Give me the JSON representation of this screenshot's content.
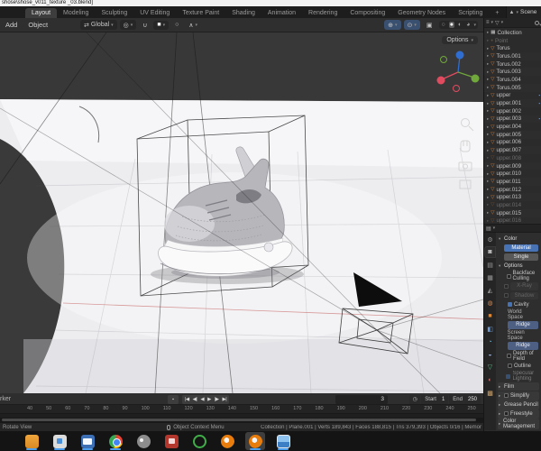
{
  "window": {
    "title": "shose\\shose_v011_texture _03.blend]"
  },
  "icons": {
    "scene": "▲",
    "list_display": "≡",
    "filter": "▽",
    "props_editor": "▤",
    "orientation": "⇄",
    "pivot": "◎",
    "magnet": "∪",
    "snap_target": "■",
    "proportional": "○",
    "falloff": "∧",
    "gizmo_toggle": "⊕",
    "overlays_toggle": "⊙",
    "xray_toggle": "▣",
    "shade_wireframe": "○",
    "shade_solid": "●",
    "shade_material": "◐",
    "shade_rendered": "◕",
    "clock": "◷",
    "record": "▪",
    "dropdown": "▾"
  },
  "topbar": {
    "tabs": [
      {
        "label": "Layout",
        "active": true
      },
      {
        "label": "Modeling"
      },
      {
        "label": "Sculpting"
      },
      {
        "label": "UV Editing"
      },
      {
        "label": "Texture Paint"
      },
      {
        "label": "Shading"
      },
      {
        "label": "Animation"
      },
      {
        "label": "Rendering"
      },
      {
        "label": "Compositing"
      },
      {
        "label": "Geometry Nodes"
      },
      {
        "label": "Scripting"
      },
      {
        "label": "+"
      }
    ],
    "scene_label": "Scene"
  },
  "viewport_header": {
    "menus": [
      {
        "label": "Add"
      },
      {
        "label": "Object"
      }
    ],
    "orientation_value": "Global"
  },
  "viewport": {
    "options_label": "Options"
  },
  "outliner": {
    "rows": [
      {
        "name": "Collection",
        "icon": "collection"
      },
      {
        "name": "Point",
        "icon": "light",
        "dim": true
      },
      {
        "name": "Torus",
        "icon": "mesh"
      },
      {
        "name": "Torus.001",
        "icon": "mesh"
      },
      {
        "name": "Torus.002",
        "icon": "mesh"
      },
      {
        "name": "Torus.003",
        "icon": "mesh"
      },
      {
        "name": "Torus.004",
        "icon": "mesh"
      },
      {
        "name": "Torus.005",
        "icon": "mesh"
      },
      {
        "name": "upper",
        "icon": "mesh",
        "wrench": true
      },
      {
        "name": "upper.001",
        "icon": "mesh",
        "wrench": true
      },
      {
        "name": "upper.002",
        "icon": "mesh"
      },
      {
        "name": "upper.003",
        "icon": "mesh",
        "wrench": true
      },
      {
        "name": "upper.004",
        "icon": "mesh"
      },
      {
        "name": "upper.005",
        "icon": "mesh"
      },
      {
        "name": "upper.006",
        "icon": "mesh"
      },
      {
        "name": "upper.007",
        "icon": "mesh"
      },
      {
        "name": "upper.008",
        "icon": "mesh",
        "dim": true
      },
      {
        "name": "upper.009",
        "icon": "mesh"
      },
      {
        "name": "upper.010",
        "icon": "mesh"
      },
      {
        "name": "upper.011",
        "icon": "mesh"
      },
      {
        "name": "upper.012",
        "icon": "mesh"
      },
      {
        "name": "upper.013",
        "icon": "mesh"
      },
      {
        "name": "upper.014",
        "icon": "mesh",
        "dim": true
      },
      {
        "name": "upper.015",
        "icon": "mesh"
      },
      {
        "name": "upper.016",
        "icon": "mesh",
        "dim": true
      }
    ]
  },
  "properties": {
    "tabs": [
      {
        "name": "tool",
        "glyph": "⚙",
        "style": "color:#9a9a9a"
      },
      {
        "name": "render",
        "glyph": "◙",
        "style": "color:#c8c8c8",
        "active": true
      },
      {
        "name": "output",
        "glyph": "▤",
        "style": "color:#9a9a9a"
      },
      {
        "name": "view-layer",
        "glyph": "▦",
        "style": "color:#9a9a9a"
      },
      {
        "name": "scene",
        "glyph": "◭",
        "style": "color:#9a9a9a"
      },
      {
        "name": "world",
        "glyph": "◍",
        "style": "color:#d08550"
      },
      {
        "name": "object",
        "glyph": "■",
        "style": "color:#d8883a"
      },
      {
        "name": "modifiers",
        "glyph": "◧",
        "style": "color:#6f9bd6"
      },
      {
        "name": "physics",
        "glyph": "◔",
        "style": "color:#6fb3d6"
      },
      {
        "name": "constraints",
        "glyph": "◒",
        "style": "color:#8fa3c0"
      },
      {
        "name": "object-data",
        "glyph": "▽",
        "style": "color:#58c088"
      },
      {
        "name": "material",
        "glyph": "◐",
        "style": "color:#d06a6a"
      },
      {
        "name": "texture",
        "glyph": "▩",
        "style": "color:#d0a060"
      }
    ],
    "rows": [
      {
        "type": "section",
        "label": "Color"
      },
      {
        "type": "btn",
        "label": "Material",
        "sel": true
      },
      {
        "type": "btn",
        "label": "Single"
      },
      {
        "type": "section",
        "label": "Options"
      },
      {
        "type": "check",
        "label": "Backface Culling"
      },
      {
        "type": "checkbtn",
        "label": "X-Ray",
        "dim": true
      },
      {
        "type": "checkbtn",
        "label": "Shadow",
        "dim": true
      },
      {
        "type": "check",
        "label": "Cavity",
        "checked": true
      },
      {
        "type": "label",
        "label": "World Space"
      },
      {
        "type": "slider",
        "label": "Ridge"
      },
      {
        "type": "label",
        "label": "Screen Space"
      },
      {
        "type": "slider",
        "label": "Ridge"
      },
      {
        "type": "check",
        "label": "Depth of Field"
      },
      {
        "type": "check",
        "label": "Outline"
      },
      {
        "type": "check",
        "label": "Specular Lighting",
        "checked": true,
        "dim": true
      },
      {
        "type": "fold",
        "label": "Film"
      },
      {
        "type": "fold",
        "label": "Simplify",
        "hasCheck": true
      },
      {
        "type": "fold",
        "label": "Grease Pencil"
      },
      {
        "type": "fold",
        "label": "Freestyle",
        "hasCheck": true
      },
      {
        "type": "fold",
        "label": "Color Management"
      }
    ]
  },
  "timeline": {
    "cropped_menu_text": "rker",
    "transport": [
      "|◀",
      "◀|",
      "◀",
      "▶",
      "|▶",
      "▶|"
    ],
    "frame_value": "3",
    "start_label": "Start",
    "start_value": "1",
    "end_label": "End",
    "end_value": "250",
    "ticks": [
      "40",
      "50",
      "60",
      "70",
      "80",
      "90",
      "100",
      "110",
      "120",
      "130",
      "140",
      "150",
      "160",
      "170",
      "180",
      "190",
      "200",
      "210",
      "220",
      "230",
      "240",
      "250"
    ]
  },
  "statusbar": {
    "left": "Rotate View",
    "context": "Object Context Menu",
    "stats": "Collection | Plane.001 | Verts 189,843 | Faces 188,815 | Tris 379,393 | Objects 0/16 | Memor"
  },
  "taskbar": {
    "apps": [
      {
        "name": "taskbar-files",
        "icon": "files",
        "indicator": true
      },
      {
        "name": "taskbar-store",
        "icon": "store",
        "indicator": true
      },
      {
        "name": "taskbar-mail",
        "icon": "mail",
        "indicator": true
      },
      {
        "name": "taskbar-chrome",
        "icon": "chrome",
        "indicator": true
      },
      {
        "name": "taskbar-gimp",
        "icon": "gimp"
      },
      {
        "name": "taskbar-video",
        "icon": "video"
      },
      {
        "name": "taskbar-ring-app",
        "icon": "ring"
      },
      {
        "name": "taskbar-blender",
        "icon": "blender"
      },
      {
        "name": "taskbar-blender-active",
        "icon": "blender",
        "active": true,
        "indicator": true
      },
      {
        "name": "taskbar-photos",
        "icon": "photos",
        "indicator": true
      }
    ]
  }
}
